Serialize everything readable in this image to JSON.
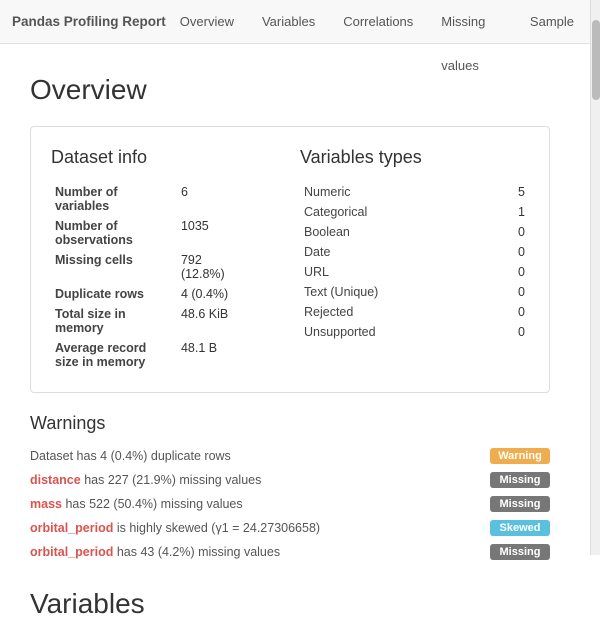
{
  "navbar": {
    "brand": "Pandas Profiling Report",
    "nav_items": [
      {
        "label": "Overview",
        "active": false
      },
      {
        "label": "Variables",
        "active": false
      },
      {
        "label": "Correlations",
        "active": false
      },
      {
        "label": "Missing values",
        "active": false
      },
      {
        "label": "Sample",
        "active": false
      }
    ]
  },
  "overview": {
    "page_title": "Overview",
    "dataset_info": {
      "title": "Dataset info",
      "rows": [
        {
          "label": "Number of variables",
          "value": "6"
        },
        {
          "label": "Number of observations",
          "value": "1035"
        },
        {
          "label": "Missing cells",
          "value": "792\n(12.8%)"
        },
        {
          "label": "Duplicate rows",
          "value": "4 (0.4%)"
        },
        {
          "label": "Total size in memory",
          "value": "48.6 KiB"
        },
        {
          "label": "Average record size in memory",
          "value": "48.1 B"
        }
      ]
    },
    "variables_types": {
      "title": "Variables types",
      "rows": [
        {
          "label": "Numeric",
          "value": "5"
        },
        {
          "label": "Categorical",
          "value": "1"
        },
        {
          "label": "Boolean",
          "value": "0"
        },
        {
          "label": "Date",
          "value": "0"
        },
        {
          "label": "URL",
          "value": "0"
        },
        {
          "label": "Text (Unique)",
          "value": "0"
        },
        {
          "label": "Rejected",
          "value": "0"
        },
        {
          "label": "Unsupported",
          "value": "0"
        }
      ]
    },
    "warnings": {
      "title": "Warnings",
      "items": [
        {
          "text_before": "Dataset has 4 (0.4%) duplicate rows",
          "var_name": "",
          "text_after": "",
          "badge": "Warning",
          "badge_type": "warning"
        },
        {
          "text_before": "",
          "var_name": "distance",
          "text_after": " has 227 (21.9%) missing values",
          "badge": "Missing",
          "badge_type": "missing"
        },
        {
          "text_before": "",
          "var_name": "mass",
          "text_after": " has 522 (50.4%) missing values",
          "badge": "Missing",
          "badge_type": "missing"
        },
        {
          "text_before": "",
          "var_name": "orbital_period",
          "text_after": " is highly skewed (γ1 = 24.27306658)",
          "badge": "Skewed",
          "badge_type": "skewed"
        },
        {
          "text_before": "",
          "var_name": "orbital_period",
          "text_after": " has 43 (4.2%) missing values",
          "badge": "Missing",
          "badge_type": "missing"
        }
      ]
    }
  },
  "variables_section": {
    "title": "Variables"
  }
}
